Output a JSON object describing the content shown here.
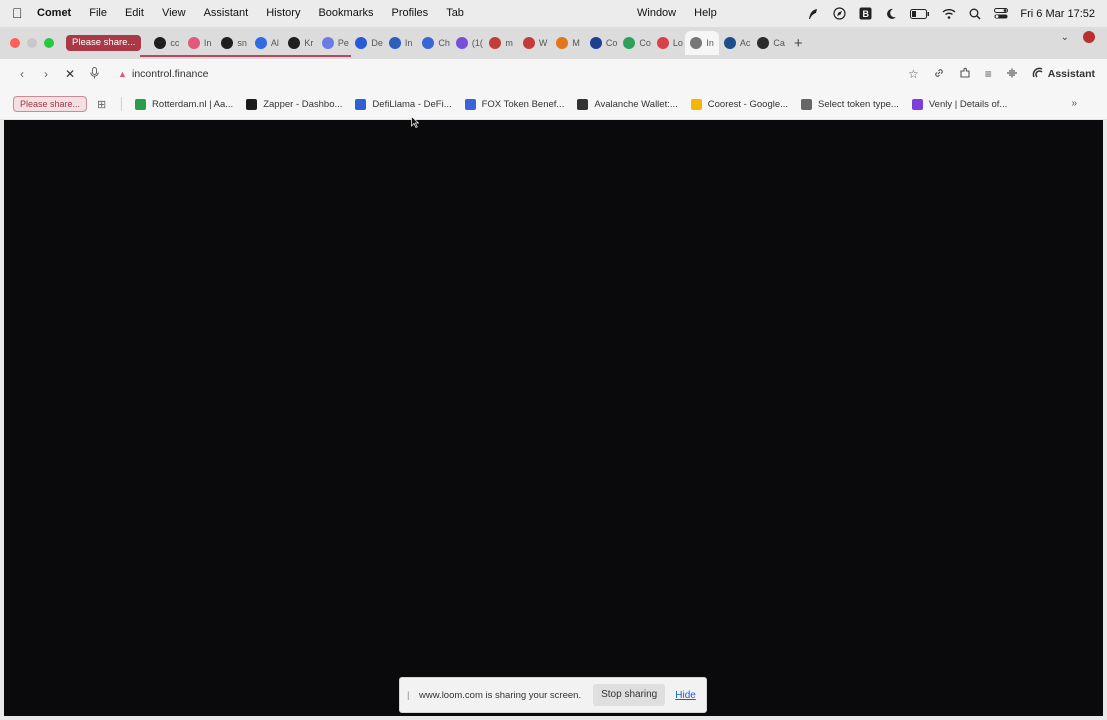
{
  "menubar": {
    "app_name": "Comet",
    "items": [
      "File",
      "Edit",
      "View",
      "Assistant",
      "History",
      "Bookmarks",
      "Profiles",
      "Tab"
    ],
    "center_items": [
      "Window",
      "Help"
    ],
    "clock": "Fri 6 Mar  17:52"
  },
  "tabstrip": {
    "share_pill": "Please share...",
    "tabs": [
      {
        "label": "cc",
        "icon": "github-icon",
        "color": "#1f1f1f"
      },
      {
        "label": "In",
        "icon": "app-icon",
        "color": "#e2597a"
      },
      {
        "label": "sn",
        "icon": "github-icon",
        "color": "#1f1f1f"
      },
      {
        "label": "Al",
        "icon": "hex-icon",
        "color": "#2f6be3"
      },
      {
        "label": "Kr",
        "icon": "github-icon",
        "color": "#1f1f1f"
      },
      {
        "label": "Pe",
        "icon": "globe-icon",
        "color": "#6a7be6"
      },
      {
        "label": "De",
        "icon": "circle-icon",
        "color": "#2859d8"
      },
      {
        "label": "In",
        "icon": "mail-icon",
        "color": "#2b5fbf"
      },
      {
        "label": "Ch",
        "icon": "hex-icon",
        "color": "#3a66d8"
      },
      {
        "label": "(1(",
        "icon": "mail-icon",
        "color": "#7a4fd8"
      },
      {
        "label": "m",
        "icon": "app-icon",
        "color": "#c43b3b"
      },
      {
        "label": "W",
        "icon": "app-icon",
        "color": "#c43b3b"
      },
      {
        "label": "M",
        "icon": "fox-icon",
        "color": "#e2761b"
      },
      {
        "label": "Co",
        "icon": "square-icon",
        "color": "#1d3f8f"
      },
      {
        "label": "Co",
        "icon": "drive-icon",
        "color": "#2fa05a"
      },
      {
        "label": "Lo",
        "icon": "record-icon",
        "color": "#d9404a"
      },
      {
        "label": "In",
        "icon": "loading-icon",
        "color": "#777777",
        "active": true
      },
      {
        "label": "Ac",
        "icon": "globe-icon",
        "color": "#1e4c8c"
      },
      {
        "label": "Ca",
        "icon": "square-icon",
        "color": "#2b2b2b"
      }
    ]
  },
  "toolbar": {
    "url": "incontrol.finance",
    "assistant_label": "Assistant"
  },
  "bookmarks": {
    "pill": "Please share...",
    "items": [
      {
        "label": "Rotterdam.nl | Aa...",
        "color": "#2a9d4a"
      },
      {
        "label": "Zapper - Dashbo...",
        "color": "#1b1b1b"
      },
      {
        "label": "DefiLlama - DeFi...",
        "color": "#2f5fd3"
      },
      {
        "label": "FOX Token Benef...",
        "color": "#3b62d6"
      },
      {
        "label": "Avalanche Wallet:...",
        "color": "#333333"
      },
      {
        "label": "Coorest - Google...",
        "color": "#f2b705"
      },
      {
        "label": "Select token type...",
        "color": "#666666"
      },
      {
        "label": "Venly | Details of...",
        "color": "#7c3fd9"
      }
    ]
  },
  "loom": {
    "message": "www.loom.com is sharing your screen.",
    "stop_label": "Stop sharing",
    "hide_label": "Hide"
  }
}
